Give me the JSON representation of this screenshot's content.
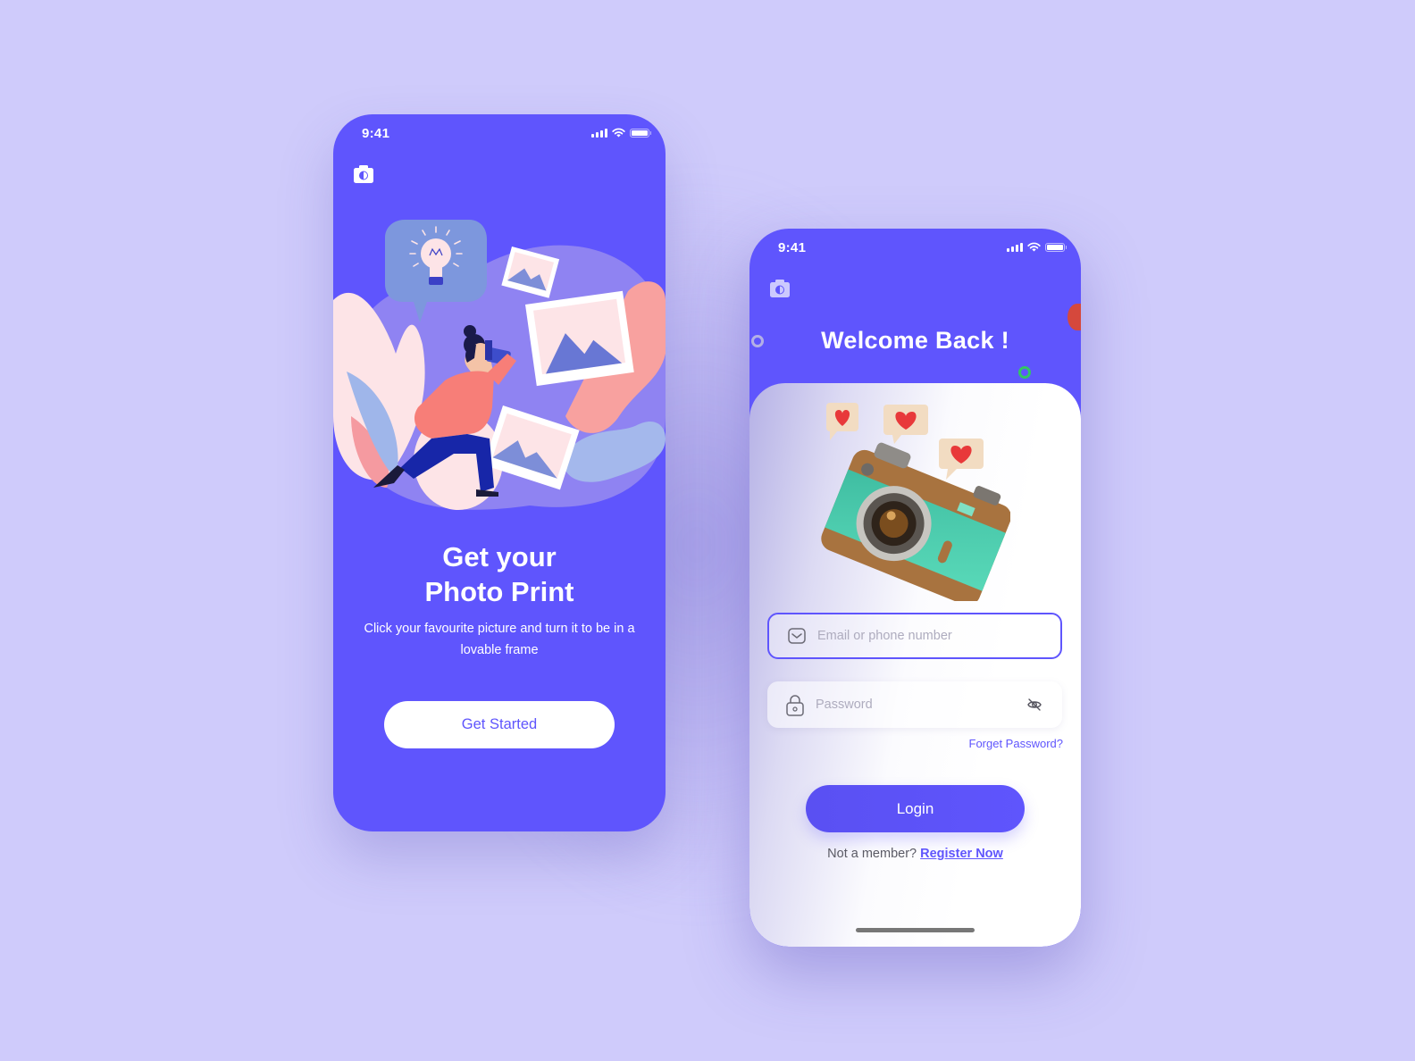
{
  "colors": {
    "background": "#cfcbfb",
    "accent": "#5f55fd",
    "white": "#ffffff"
  },
  "onboarding_screen": {
    "status_bar": {
      "time": "9:41"
    },
    "logo_icon": "camera-icon",
    "illustration": "photographer-illustration",
    "title_line1": "Get your",
    "title_line2": "Photo Print",
    "subtitle": "Click your favourite picture and turn it to be in a lovable frame",
    "get_started_label": "Get Started"
  },
  "login_screen": {
    "status_bar": {
      "time": "9:41"
    },
    "logo_icon": "camera-icon",
    "title": "Welcome Back !",
    "illustration": "camera-with-heart-bubbles",
    "email": {
      "icon": "mail-icon",
      "placeholder": "Email or phone number",
      "value": ""
    },
    "password": {
      "icon": "lock-icon",
      "placeholder": "Password",
      "value": "",
      "toggle_icon": "eye-off-icon"
    },
    "forgot_label": "Forget Password?",
    "login_label": "Login",
    "register_prompt": "Not a member?",
    "register_label": "Register Now"
  }
}
